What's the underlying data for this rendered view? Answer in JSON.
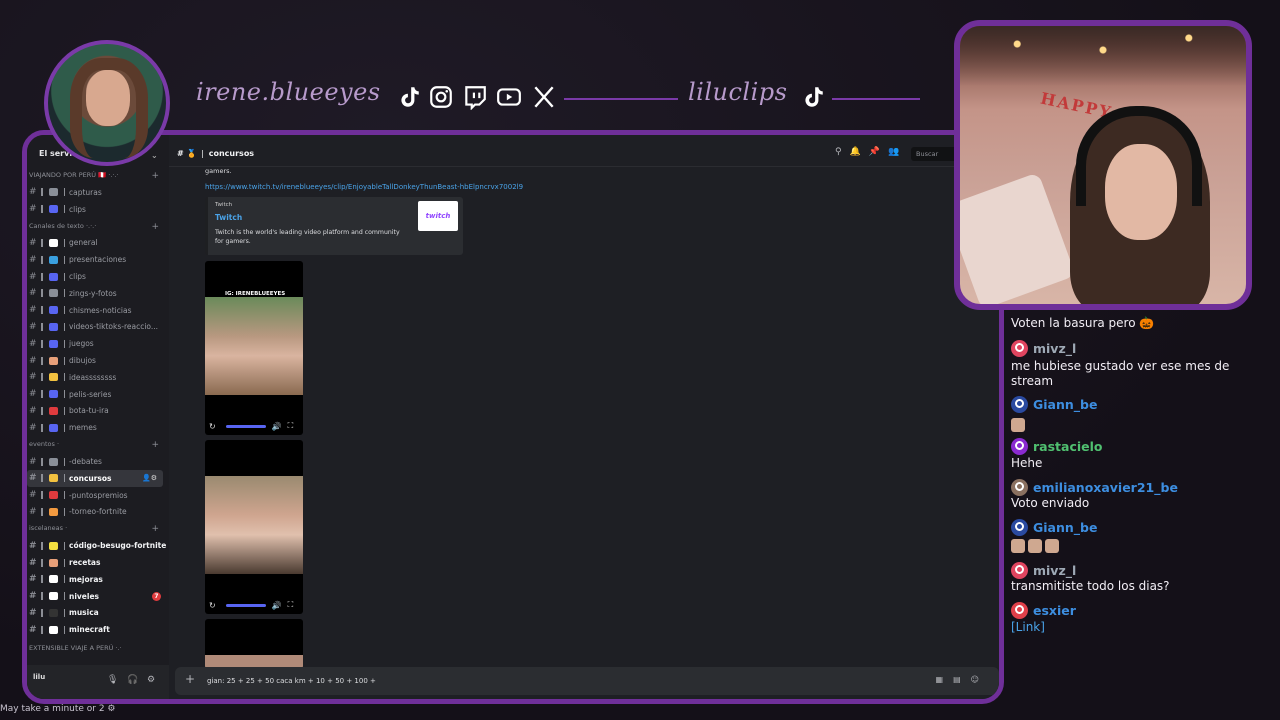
{
  "banner": {
    "handle_main": "irene.blueeyes",
    "handle_clips": "liluclips",
    "socials": [
      "tiktok-icon",
      "instagram-icon",
      "twitch-icon",
      "youtube-icon",
      "x-icon"
    ]
  },
  "discord": {
    "server_name": "El servido",
    "user": "lilu",
    "categories": [
      {
        "label": "VIAJANDO POR PERÚ 🇵🇪 ·.·.·",
        "channels": [
          {
            "name": "capturas",
            "emoji_color": "#8a8f98"
          },
          {
            "name": "clips",
            "emoji_color": "#5865f2"
          }
        ]
      },
      {
        "label": "Canales de texto ·.·.·",
        "channels": [
          {
            "name": "general",
            "emoji_color": "#ffffff"
          },
          {
            "name": "presentaciones",
            "emoji_color": "#3aa0e0"
          },
          {
            "name": "clips",
            "emoji_color": "#5865f2"
          },
          {
            "name": "zings-y-fotos",
            "emoji_color": "#8a8f98"
          },
          {
            "name": "chismes-noticias",
            "emoji_color": "#5865f2"
          },
          {
            "name": "videos-tiktoks-reaccio...",
            "emoji_color": "#5865f2"
          },
          {
            "name": "juegos",
            "emoji_color": "#5865f2"
          },
          {
            "name": "dibujos",
            "emoji_color": "#e8a07a"
          },
          {
            "name": "ideassssssss",
            "emoji_color": "#f3c240"
          },
          {
            "name": "pelis-series",
            "emoji_color": "#5865f2"
          },
          {
            "name": "bota-tu-ira",
            "emoji_color": "#e03b3e"
          },
          {
            "name": "memes",
            "emoji_color": "#5865f2"
          }
        ]
      },
      {
        "label": "eventos ·",
        "channels": [
          {
            "name": "-debates",
            "emoji_color": "#8a8f98"
          },
          {
            "name": "concursos",
            "emoji_color": "#f3c240",
            "active": true
          },
          {
            "name": "-puntospremios",
            "emoji_color": "#e03b3e"
          },
          {
            "name": "-torneo-fortnite",
            "emoji_color": "#f39a40"
          }
        ]
      },
      {
        "label": "iscelaneas ·",
        "channels": [
          {
            "name": "código-besugo-fortnite",
            "emoji_color": "#f3e040",
            "bold": true
          },
          {
            "name": "recetas",
            "emoji_color": "#e8a07a",
            "bold": true
          },
          {
            "name": "mejoras",
            "emoji_color": "#ffffff",
            "bold": true
          },
          {
            "name": "niveles",
            "emoji_color": "#ffffff",
            "bold": true,
            "badge": "7"
          },
          {
            "name": "musica",
            "emoji_color": "#333333",
            "bold": true
          },
          {
            "name": "minecraft",
            "emoji_color": "#ffffff",
            "bold": true
          }
        ]
      }
    ],
    "bottom_category": "EXTENSIBLE VIAJE A PERÚ ·.·",
    "chat_header": {
      "channel": "concursos",
      "search_placeholder": "Buscar"
    },
    "messages": {
      "partial_text": "gamers.",
      "link": "https://www.twitch.tv/ireneblueeyes/clip/EnjoyableTallDonkeyThunBeast-hbElpncrvx7002l9",
      "embed": {
        "provider": "Twitch",
        "title": "Twitch",
        "description": "Twitch is the world's leading video platform and community for gamers.",
        "thumb_text": "twitch"
      },
      "video_caption": "IG: IRENEBLUEEYES"
    },
    "composer_text": "gian: 25 + 25 + 50 caca km + 10 + 50 + 100 +"
  },
  "chat": [
    {
      "type": "text",
      "text": "Voten la basura pero 🎃"
    },
    {
      "type": "user",
      "name": "mivz_l",
      "color": "#9ea9b5",
      "avatar": "#e04560"
    },
    {
      "type": "text",
      "text": "me hubiese gustado ver ese mes de"
    },
    {
      "type": "text",
      "text": "stream"
    },
    {
      "type": "user",
      "name": "Giann_be",
      "color": "#3d8ee0",
      "avatar": "#2a4aa0"
    },
    {
      "type": "user",
      "name": "rastacielo",
      "color": "#50c070",
      "avatar": "#8a2ad0"
    },
    {
      "type": "text",
      "text": "Hehe"
    },
    {
      "type": "user",
      "name": "emilianoxavier21_be",
      "color": "#3d8ee0",
      "avatar": "#8a7060"
    },
    {
      "type": "text",
      "text": "Voto enviado"
    },
    {
      "type": "user",
      "name": "Giann_be",
      "color": "#3d8ee0",
      "avatar": "#2a4aa0"
    },
    {
      "type": "user",
      "name": "mivz_l",
      "color": "#9ea9b5",
      "avatar": "#e04560"
    },
    {
      "type": "text",
      "text": "transmitiste todo los dias?"
    },
    {
      "type": "user",
      "name": "esxier",
      "color": "#3d8ee0",
      "avatar": "#e0404a"
    },
    {
      "type": "link",
      "text": "[Link]"
    }
  ],
  "footer": "May take a minute or 2 ⚙",
  "colors": {
    "frame": "#6f2f99",
    "accent": "#5865f2",
    "link": "#4aa3e8"
  }
}
